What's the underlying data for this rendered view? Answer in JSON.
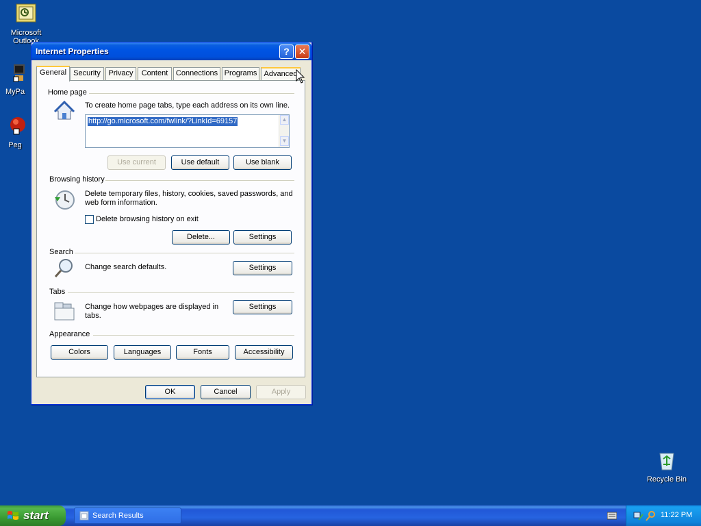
{
  "desktop": {
    "icons": [
      {
        "label": "Microsoft Outlook"
      },
      {
        "label": "MyPa"
      },
      {
        "label": "Peg"
      },
      {
        "label": "Recycle Bin"
      }
    ]
  },
  "window": {
    "title": "Internet Properties",
    "help_label": "?",
    "close_label": "✕",
    "tabs": [
      "General",
      "Security",
      "Privacy",
      "Content",
      "Connections",
      "Programs",
      "Advanced"
    ],
    "active_tab": "General",
    "home_page": {
      "group_label": "Home page",
      "description": "To create home page tabs, type each address on its own line.",
      "url": "http://go.microsoft.com/fwlink/?LinkId=69157",
      "use_current": "Use current",
      "use_default": "Use default",
      "use_blank": "Use blank"
    },
    "browsing_history": {
      "group_label": "Browsing history",
      "description": "Delete temporary files, history, cookies, saved passwords, and web form information.",
      "checkbox_label": "Delete browsing history on exit",
      "checkbox_checked": false,
      "delete_button": "Delete...",
      "settings_button": "Settings"
    },
    "search": {
      "group_label": "Search",
      "description": "Change search defaults.",
      "settings_button": "Settings"
    },
    "tabs_section": {
      "group_label": "Tabs",
      "description": "Change how webpages are displayed in tabs.",
      "settings_button": "Settings"
    },
    "appearance": {
      "group_label": "Appearance",
      "buttons": [
        "Colors",
        "Languages",
        "Fonts",
        "Accessibility"
      ]
    },
    "footer": {
      "ok": "OK",
      "cancel": "Cancel",
      "apply": "Apply"
    }
  },
  "taskbar": {
    "start_label": "start",
    "task_label": "Search Results",
    "clock": "11:22 PM"
  },
  "colors": {
    "desktop": "#0a4aa0",
    "titlebar": "#0054e3",
    "dialog": "#ece9d8",
    "selection": "#316ac5"
  }
}
